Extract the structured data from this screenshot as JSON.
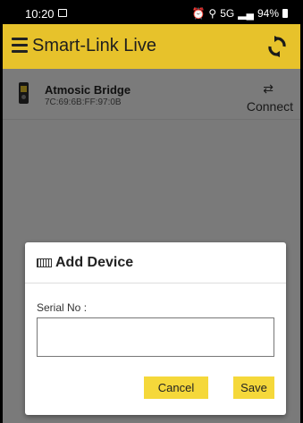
{
  "status_bar": {
    "time": "10:20",
    "network": "5G",
    "battery": "94%"
  },
  "app_bar": {
    "title": "Smart-Link Live",
    "menu_icon": "hamburger-icon",
    "refresh_icon": "refresh-icon"
  },
  "device": {
    "name": "Atmosic Bridge",
    "mac": "7C:69:6B:FF:97:0B",
    "action_label": "Connect",
    "icon": "swap-icon"
  },
  "dialog": {
    "title": "Add Device",
    "icon": "keyboard-icon",
    "field_label": "Serial No :",
    "serial_value": "",
    "cancel_label": "Cancel",
    "save_label": "Save"
  },
  "colors": {
    "accent": "#e7c22b",
    "button": "#f5d83a"
  }
}
